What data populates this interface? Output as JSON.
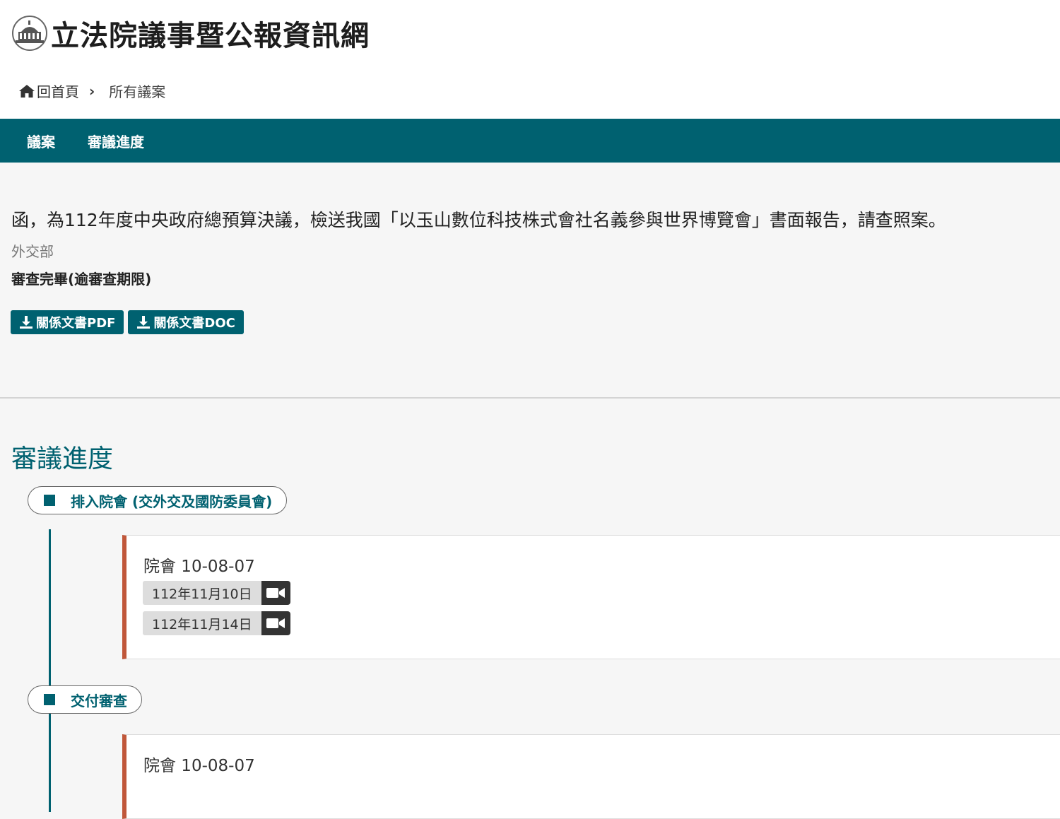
{
  "site": {
    "title": "立法院議事暨公報資訊網"
  },
  "breadcrumb": {
    "home": "回首頁",
    "current": "所有議案"
  },
  "tabs": [
    "議案",
    "審議進度"
  ],
  "bill": {
    "title": "函，為112年度中央政府總預算決議，檢送我國「以玉山數位科技株式會社名義參與世界博覽會」書面報告，請查照案。",
    "proposer": "外交部",
    "status": "審查完畢(逾審查期限)",
    "buttons": {
      "pdf": "關係文書PDF",
      "doc": "關係文書DOC"
    }
  },
  "progress": {
    "heading": "審議進度",
    "stages": [
      {
        "label": "排入院會 (交外交及國防委員會)",
        "meeting": "院會 10-08-07",
        "dates": [
          "112年11月10日",
          "112年11月14日"
        ]
      },
      {
        "label": "交付審查",
        "meeting": "院會 10-08-07",
        "dates": []
      }
    ]
  },
  "icons": {
    "home": "home-icon",
    "chevron": "chevron-right-icon",
    "download": "download-icon",
    "video": "video-camera-icon",
    "emblem": "legislative-yuan-emblem"
  },
  "colors": {
    "primary": "#006170",
    "accent": "#c0573a"
  }
}
